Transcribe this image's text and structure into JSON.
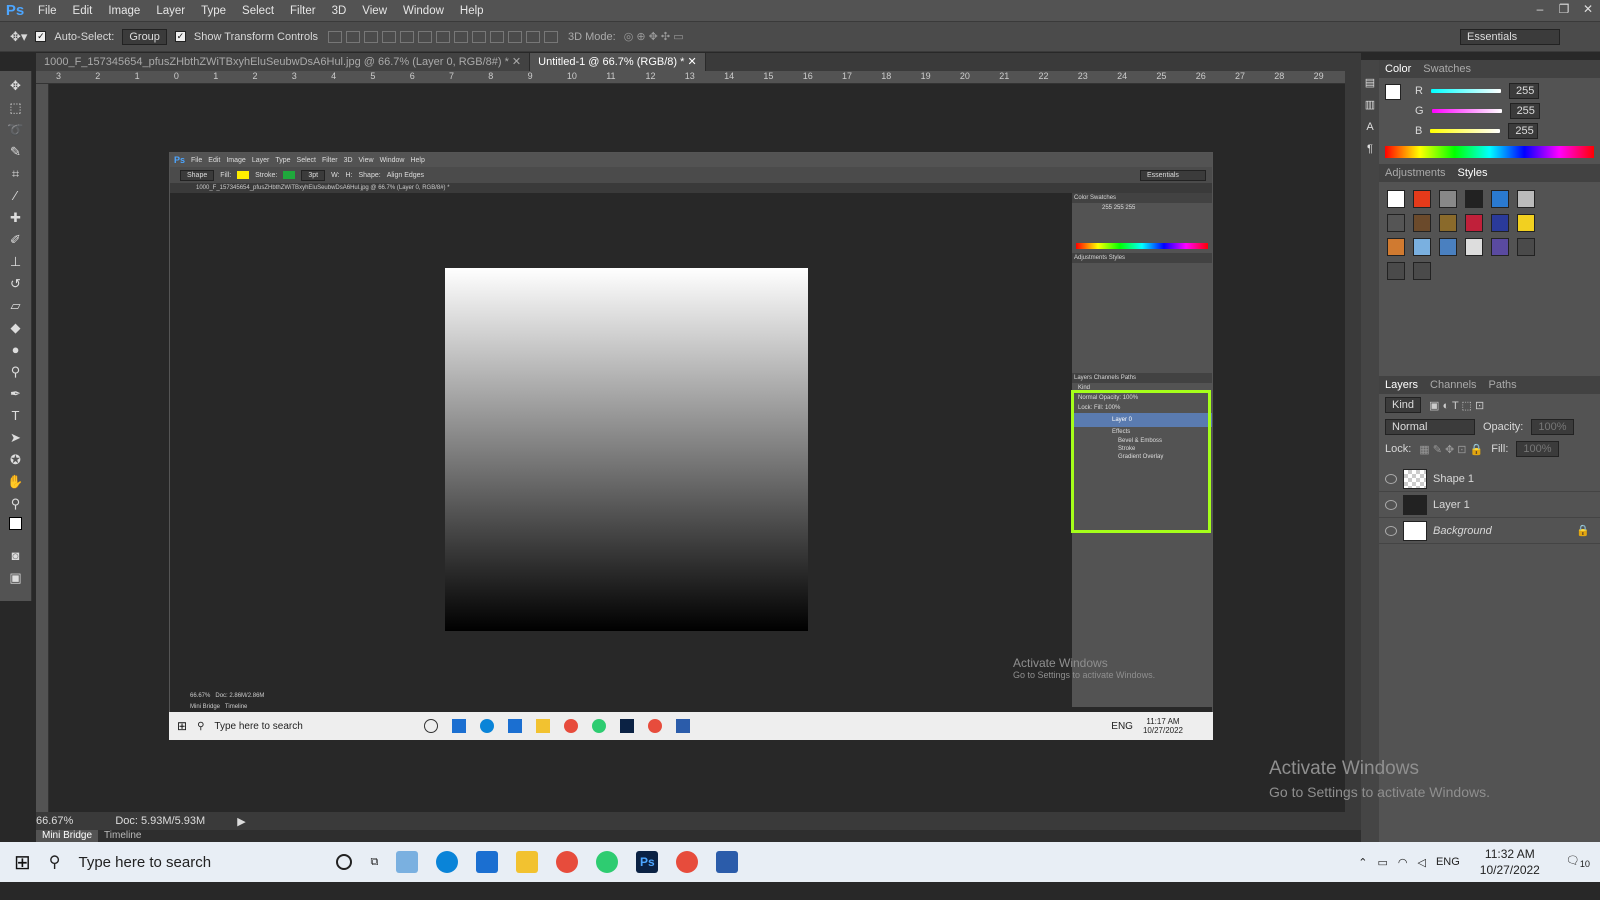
{
  "app": {
    "logo": "Ps"
  },
  "menu": [
    "File",
    "Edit",
    "Image",
    "Layer",
    "Type",
    "Select",
    "Filter",
    "3D",
    "View",
    "Window",
    "Help"
  ],
  "options": {
    "auto_select_label": "Auto-Select:",
    "auto_select_value": "Group",
    "transform_label": "Show Transform Controls",
    "mode_label": "3D Mode:",
    "workspace": "Essentials"
  },
  "tabs": [
    {
      "label": "1000_F_157345654_pfusZHbthZWiTBxyhEluSeubwDsA6Hul.jpg @ 66.7% (Layer 0, RGB/8#) *",
      "active": false
    },
    {
      "label": "Untitled-1 @ 66.7% (RGB/8) *",
      "active": true
    }
  ],
  "ruler_top": [
    "3",
    "2",
    "1",
    "0",
    "1",
    "2",
    "3",
    "4",
    "5",
    "6",
    "7",
    "8",
    "9",
    "10",
    "11",
    "12",
    "13",
    "14",
    "15",
    "16",
    "17",
    "18",
    "19",
    "20",
    "21",
    "22",
    "23",
    "24",
    "25",
    "26",
    "27",
    "28",
    "29"
  ],
  "status": {
    "zoom": "66.67%",
    "doc": "Doc: 5.93M/5.93M"
  },
  "bottom_tabs": [
    "Mini Bridge",
    "Timeline"
  ],
  "color_panel": {
    "tabs": [
      "Color",
      "Swatches"
    ],
    "r_label": "R",
    "g_label": "G",
    "b_label": "B",
    "r": "255",
    "g": "255",
    "b": "255"
  },
  "adj_panel": {
    "tabs": [
      "Adjustments",
      "Styles"
    ]
  },
  "layers_panel": {
    "tabs": [
      "Layers",
      "Channels",
      "Paths"
    ],
    "kind": "Kind",
    "blend": "Normal",
    "opacity_label": "Opacity:",
    "opacity": "100%",
    "lock_label": "Lock:",
    "fill_label": "Fill:",
    "fill": "100%",
    "layers": [
      {
        "name": "Shape 1"
      },
      {
        "name": "Layer 1"
      },
      {
        "name": "Background"
      }
    ]
  },
  "inner": {
    "menu": [
      "File",
      "Edit",
      "Image",
      "Layer",
      "Type",
      "Select",
      "Filter",
      "3D",
      "View",
      "Window",
      "Help"
    ],
    "options": {
      "shape": "Shape",
      "fill": "Fill:",
      "stroke": "Stroke:",
      "size": "3pt",
      "w": "W:",
      "h": "H:",
      "shape_label": "Shape:",
      "align": "Align Edges",
      "workspace": "Essentials"
    },
    "tab": "1000_F_157345654_pfusZHbthZWiTBxyhEluSeubwDsA6Hul.jpg @ 66.7% (Layer 0, RGB/8#) *",
    "status": {
      "zoom": "66.67%",
      "doc": "Doc: 2.86M/2.86M"
    },
    "bottom_tabs": [
      "Mini Bridge",
      "Timeline"
    ],
    "color_tabs": [
      "Color",
      "Swatches"
    ],
    "r": "255",
    "g": "255",
    "b": "255",
    "adj_tabs": [
      "Adjustments",
      "Styles"
    ],
    "layers_tabs": [
      "Layers",
      "Channels",
      "Paths"
    ],
    "kind": "Kind",
    "blend": "Normal",
    "opacity_label": "Opacity:",
    "opacity": "100%",
    "lock_label": "Lock:",
    "fill_label": "Fill:",
    "fill": "100%",
    "layer_name": "Layer 0",
    "effects": [
      "Effects",
      "Bevel & Emboss",
      "Stroke",
      "Gradient Overlay"
    ],
    "watermark_title": "Activate Windows",
    "watermark_sub": "Go to Settings to activate Windows.",
    "taskbar_search": "Type here to search",
    "time": "11:17 AM",
    "date": "10/27/2022",
    "lang": "ENG"
  },
  "watermark": {
    "title": "Activate Windows",
    "sub": "Go to Settings to activate Windows."
  },
  "taskbar": {
    "search": "Type here to search",
    "lang": "ENG",
    "time": "11:32 AM",
    "date": "10/27/2022",
    "notif": "10"
  }
}
